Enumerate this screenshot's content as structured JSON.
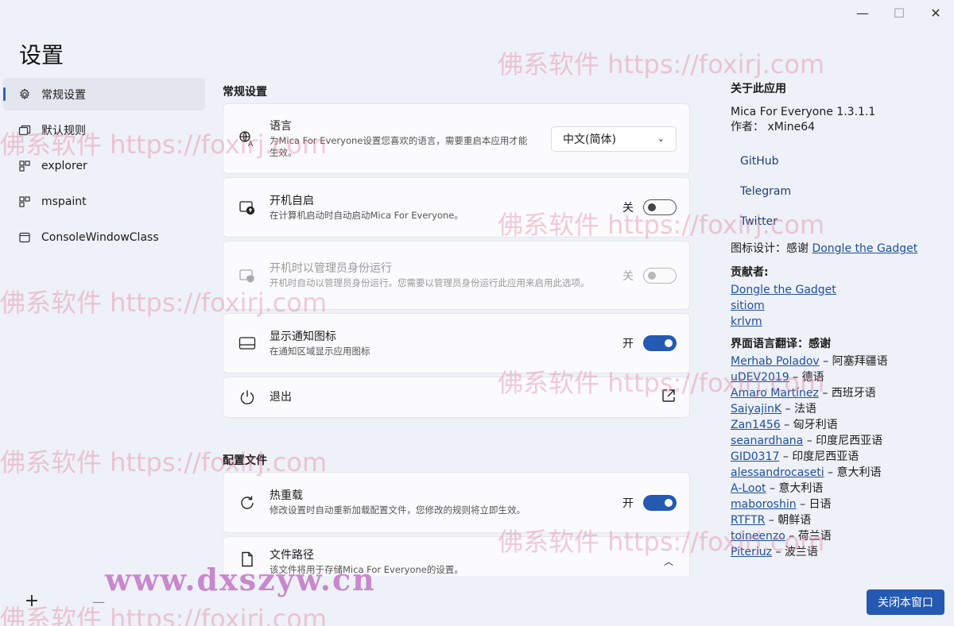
{
  "window": {
    "minimize": "—",
    "maximize": "☐",
    "close": "✕"
  },
  "app": {
    "title": "设置"
  },
  "sidebar": {
    "items": [
      {
        "label": "常规设置",
        "icon": "gear-icon",
        "active": true
      },
      {
        "label": "默认规则",
        "icon": "windows-stack-icon"
      },
      {
        "label": "explorer",
        "icon": "app-grid-icon"
      },
      {
        "label": "mspaint",
        "icon": "app-grid-icon"
      },
      {
        "label": "ConsoleWindowClass",
        "icon": "window-icon"
      }
    ],
    "add_label": "+",
    "remove_label": "—"
  },
  "general": {
    "section_title": "常规设置",
    "language": {
      "title": "语言",
      "desc": "为Mica For Everyone设置您喜欢的语言，需要重启本应用才能生效。",
      "selected": "中文(简体)"
    },
    "startup": {
      "title": "开机自启",
      "desc": "在计算机启动时自动启动Mica For Everyone。",
      "state": "关"
    },
    "admin": {
      "title": "开机时以管理员身份运行",
      "desc": "开机时自动以管理员身份运行。您需要以管理员身份运行此应用来启用此选项。",
      "state": "关"
    },
    "tray": {
      "title": "显示通知图标",
      "desc": "在通知区域显示应用图标",
      "state": "开"
    },
    "exit": {
      "title": "退出"
    }
  },
  "config": {
    "section_title": "配置文件",
    "hot_reload": {
      "title": "热重载",
      "desc": "修改设置时自动重新加载配置文件，您修改的规则将立即生效。",
      "state": "开"
    },
    "file_path": {
      "title": "文件路径",
      "desc": "该文件将用于存储Mica For Everyone的设置。"
    }
  },
  "about": {
    "title": "关于此应用",
    "version": "Mica For Everyone 1.3.1.1",
    "author_label": "作者：",
    "author": "xMine64",
    "links": [
      "GitHub",
      "Telegram",
      "Twitter"
    ],
    "icon_design_label": "图标设计：感谢",
    "icon_designer": "Dongle the Gadget",
    "contributors_title": "贡献者:",
    "contributors": [
      "Dongle the Gadget",
      "sitiom",
      "krlvm"
    ],
    "translation_title": "界面语言翻译：感谢",
    "translators": [
      {
        "name": "Merhab Poladov",
        "lang": "阿塞拜疆语"
      },
      {
        "name": "uDEV2019",
        "lang": "德语"
      },
      {
        "name": "Amaro Martínez",
        "lang": "西班牙语"
      },
      {
        "name": "SaiyajinK",
        "lang": "法语"
      },
      {
        "name": "Zan1456",
        "lang": "匈牙利语"
      },
      {
        "name": "seanardhana",
        "lang": "印度尼西亚语"
      },
      {
        "name": "GID0317",
        "lang": "印度尼西亚语"
      },
      {
        "name": "alessandrocaseti",
        "lang": "意大利语"
      },
      {
        "name": "A-Loot",
        "lang": "意大利语"
      },
      {
        "name": "maboroshin",
        "lang": "日语"
      },
      {
        "name": "RTFTR",
        "lang": "朝鲜语"
      },
      {
        "name": "toineenzo",
        "lang": "荷兰语"
      },
      {
        "name": "Piteriuz",
        "lang": "波兰语"
      }
    ],
    "dash": " – "
  },
  "close_button": "关闭本窗口",
  "watermarks": {
    "text": "佛系软件 https://foxirj.com",
    "site": "www.dxszyw.cn"
  }
}
